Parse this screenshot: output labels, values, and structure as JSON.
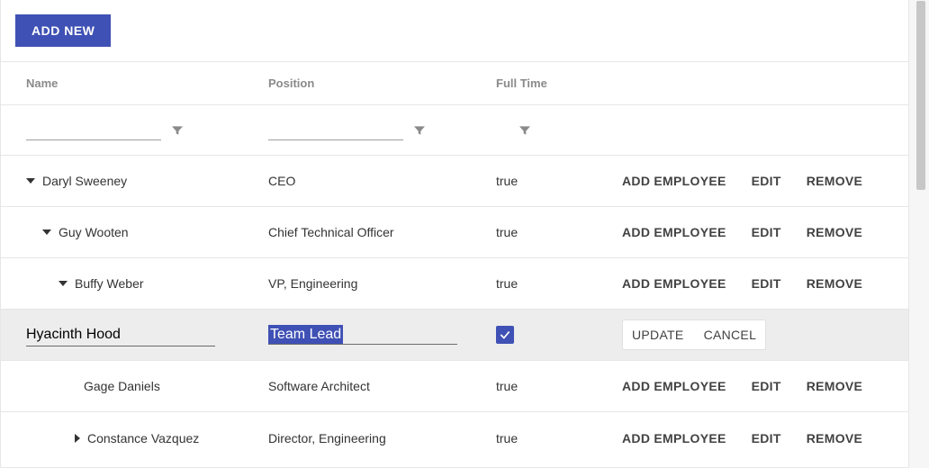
{
  "toolbar": {
    "addNew": "ADD NEW"
  },
  "headers": {
    "name": "Name",
    "position": "Position",
    "fullTime": "Full Time"
  },
  "actions": {
    "addEmployee": "ADD EMPLOYEE",
    "edit": "EDIT",
    "remove": "REMOVE",
    "update": "UPDATE",
    "cancel": "CANCEL"
  },
  "filters": {
    "name": "",
    "position": ""
  },
  "rows": [
    {
      "depth": 0,
      "toggle": "expanded",
      "name": "Daryl Sweeney",
      "position": "CEO",
      "fullTime": "true"
    },
    {
      "depth": 1,
      "toggle": "expanded",
      "name": "Guy Wooten",
      "position": "Chief Technical Officer",
      "fullTime": "true"
    },
    {
      "depth": 2,
      "toggle": "expanded",
      "name": "Buffy Weber",
      "position": "VP, Engineering",
      "fullTime": "true"
    },
    {
      "depth": 3,
      "toggle": "none",
      "name": "Gage Daniels",
      "position": "Software Architect",
      "fullTime": "true"
    },
    {
      "depth": 3,
      "toggle": "collapsed",
      "name": "Constance Vazquez",
      "position": "Director, Engineering",
      "fullTime": "true"
    }
  ],
  "editingRow": {
    "name": "Hyacinth Hood",
    "position": "Team Lead",
    "fullTimeChecked": true
  }
}
